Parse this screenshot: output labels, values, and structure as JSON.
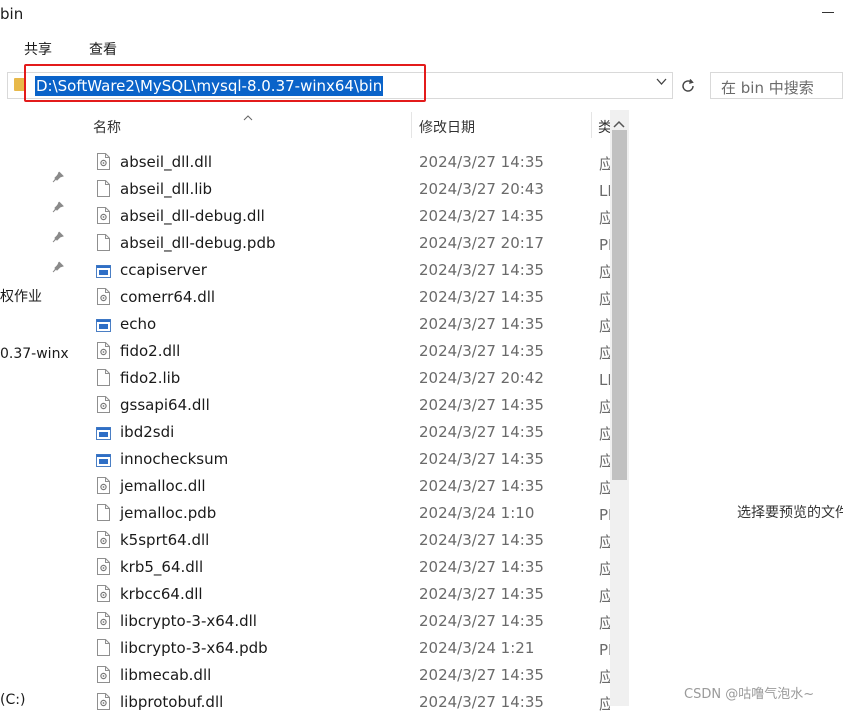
{
  "window": {
    "title": "bin"
  },
  "ribbon": {
    "tabs": [
      {
        "label": "共享"
      },
      {
        "label": "查看"
      }
    ]
  },
  "address_bar": {
    "path": "D:\\SoftWare2\\MySQL\\mysql-8.0.37-winx64\\bin"
  },
  "search": {
    "placeholder": "在 bin 中搜索"
  },
  "nav_pane": {
    "items": [
      {
        "label": "权作业"
      },
      {
        "label": "0.37-winx"
      },
      {
        "label": "(C:)"
      }
    ]
  },
  "columns": {
    "name": "名称",
    "date": "修改日期",
    "type": "类"
  },
  "files": [
    {
      "name": "abseil_dll.dll",
      "date": "2024/3/27 14:35",
      "type": "应用程序扩展",
      "icon": "dll-icon"
    },
    {
      "name": "abseil_dll.lib",
      "date": "2024/3/27 20:43",
      "type": "LIB 文件",
      "icon": "file-icon"
    },
    {
      "name": "abseil_dll-debug.dll",
      "date": "2024/3/27 14:35",
      "type": "应用程序扩展",
      "icon": "dll-icon"
    },
    {
      "name": "abseil_dll-debug.pdb",
      "date": "2024/3/27 20:17",
      "type": "PDB 文件",
      "icon": "file-icon"
    },
    {
      "name": "ccapiserver",
      "date": "2024/3/27 14:35",
      "type": "应用程序",
      "icon": "exe-icon"
    },
    {
      "name": "comerr64.dll",
      "date": "2024/3/27 14:35",
      "type": "应用程序扩展",
      "icon": "dll-icon"
    },
    {
      "name": "echo",
      "date": "2024/3/27 14:35",
      "type": "应用程序",
      "icon": "exe-icon"
    },
    {
      "name": "fido2.dll",
      "date": "2024/3/27 14:35",
      "type": "应用程序扩展",
      "icon": "dll-icon"
    },
    {
      "name": "fido2.lib",
      "date": "2024/3/27 20:42",
      "type": "LIB 文件",
      "icon": "file-icon"
    },
    {
      "name": "gssapi64.dll",
      "date": "2024/3/27 14:35",
      "type": "应用程序扩展",
      "icon": "dll-icon"
    },
    {
      "name": "ibd2sdi",
      "date": "2024/3/27 14:35",
      "type": "应用程序",
      "icon": "exe-icon"
    },
    {
      "name": "innochecksum",
      "date": "2024/3/27 14:35",
      "type": "应用程序",
      "icon": "exe-icon"
    },
    {
      "name": "jemalloc.dll",
      "date": "2024/3/27 14:35",
      "type": "应用程序扩展",
      "icon": "dll-icon"
    },
    {
      "name": "jemalloc.pdb",
      "date": "2024/3/24 1:10",
      "type": "PDB 文件",
      "icon": "file-icon"
    },
    {
      "name": "k5sprt64.dll",
      "date": "2024/3/27 14:35",
      "type": "应用程序扩展",
      "icon": "dll-icon"
    },
    {
      "name": "krb5_64.dll",
      "date": "2024/3/27 14:35",
      "type": "应用程序扩展",
      "icon": "dll-icon"
    },
    {
      "name": "krbcc64.dll",
      "date": "2024/3/27 14:35",
      "type": "应用程序扩展",
      "icon": "dll-icon"
    },
    {
      "name": "libcrypto-3-x64.dll",
      "date": "2024/3/27 14:35",
      "type": "应用程序扩展",
      "icon": "dll-icon"
    },
    {
      "name": "libcrypto-3-x64.pdb",
      "date": "2024/3/24 1:21",
      "type": "PDB 文件",
      "icon": "file-icon"
    },
    {
      "name": "libmecab.dll",
      "date": "2024/3/27 14:35",
      "type": "应用程序扩展",
      "icon": "dll-icon"
    },
    {
      "name": "libprotobuf.dll",
      "date": "2024/3/27 14:35",
      "type": "应用程序扩展",
      "icon": "dll-icon"
    }
  ],
  "preview": {
    "text": "选择要预览的文件。"
  },
  "watermark": {
    "text": "CSDN @咕噜气泡水~"
  },
  "colors": {
    "selection": "#0a63c9",
    "highlight_box": "#e31b1b",
    "folder": "#e8b94a"
  }
}
